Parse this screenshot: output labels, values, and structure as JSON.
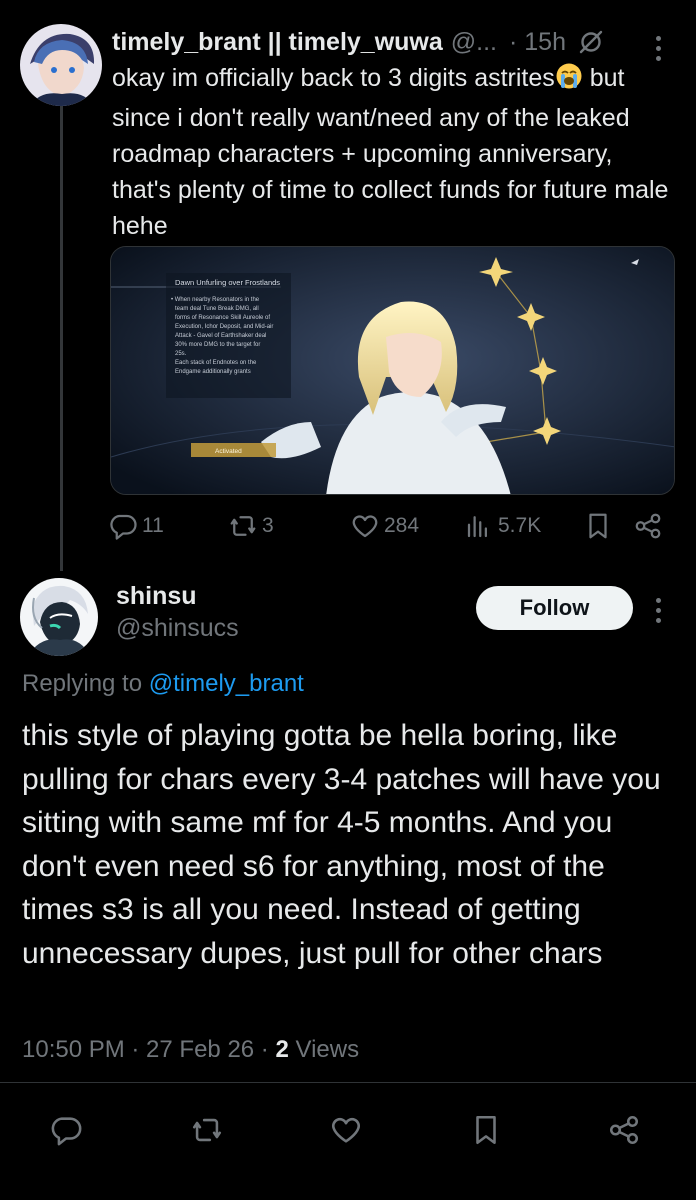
{
  "parent_tweet": {
    "display_name": "timely_brant || timely_wuwa",
    "handle": "@...",
    "time": "· 15h",
    "text": "okay im officially back to 3 digits astrites",
    "text_continued": " but since i don't really want/need any of the leaked roadmap characters + upcoming anniversary, that's plenty of time to collect funds for future male hehe",
    "emoji": "loudly-crying-face",
    "media": {
      "title": "Dawn Unfurling over Frostlands",
      "body": [
        "• When nearby Resonators in the",
        "team deal Tune Break DMG, all",
        "forms of Resonance Skill Aureole of",
        "Execution, Ichor Deposit, and Mid-air",
        "Attack - Gavel of Earthshaker deal",
        "30% more DMG to the target for",
        "25s.",
        "Each stack of Endnotes on the",
        "Endgame additionally grants"
      ],
      "button": "Activated"
    },
    "stats": {
      "replies": "11",
      "reposts": "3",
      "likes": "284",
      "views": "5.7K"
    }
  },
  "main_tweet": {
    "display_name": "shinsu",
    "handle": "@shinsucs",
    "follow_label": "Follow",
    "replying_prefix": "Replying to",
    "replying_handle": "@timely_brant",
    "text": "this style of playing gotta be hella boring, like pulling for chars every 3-4 patches will have you sitting with same mf for 4-5 months. And you don't even need s6 for anything, most of the times s3 is all you need. Instead of getting unnecessary dupes, just pull for other chars",
    "timestamp": "10:50 PM · 27 Feb 26 · ",
    "views_count": "2",
    "views_label": " Views"
  },
  "colors": {
    "background": "#000000",
    "text": "#e7e9ea",
    "muted": "#71767b",
    "link": "#1d9bf0",
    "follow_bg": "#eff3f4"
  },
  "icons": [
    "grok-icon",
    "more-icon",
    "reply-icon",
    "repost-icon",
    "like-icon",
    "views-icon",
    "bookmark-icon",
    "share-icon"
  ]
}
